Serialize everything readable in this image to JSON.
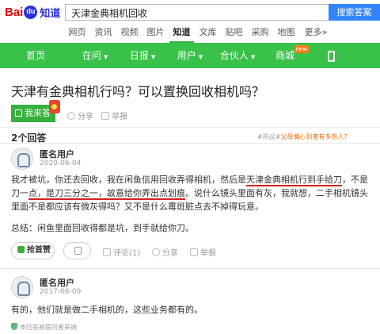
{
  "header": {
    "logo_left": "Bai",
    "logo_paw": "du",
    "logo_zhidao": "知道",
    "search_value": "天津金典相机回收",
    "search_button": "搜索答案"
  },
  "channels": [
    "网页",
    "资讯",
    "视频",
    "图片",
    "知道",
    "文库",
    "贴吧",
    "采购",
    "地图",
    "更多»"
  ],
  "channels_active_index": 4,
  "nav": {
    "items": [
      "首页",
      "在问",
      "日报",
      "用户",
      "合伙人",
      "商城"
    ],
    "new_badge": "new",
    "accent": "#38c24a"
  },
  "question": {
    "title": "天津有金典相机行吗？可以置换回收相机吗？",
    "answer_button": "我来答",
    "share": "分享",
    "report": "举报"
  },
  "answers_count": "2个回答",
  "hot": {
    "tag": "#热议#",
    "text": "父母偏心到害有多伤人？"
  },
  "answer1": {
    "user": "匿名用户",
    "date": "2020-06-04",
    "para1_a": "我才被坑，你还去回收，我在闲鱼信用回收弄得相机，然后是",
    "para1_u1": "天津金典相机行到手给刀",
    "para1_b": "，不是刀一",
    "para1_u2": "点，是刀三分之一，故意给你弄出点划痕",
    "para1_c": "。说什么镜头里面有灰，我就想，二手相机镜头里面不是都应该有微灰得吗？又不是什么霉斑脏点去不掉得玩意。",
    "para2": "总结：闲鱼里面回收得都是坑，到手就给你刀。",
    "helpful": "抢首赞",
    "comment": "评论(1)",
    "share": "分享",
    "report": "举报"
  },
  "answer2": {
    "user": "匿名用户",
    "date": "2017-06-09",
    "text": "有的，他们就是做二手相机的，这些业务都有的。",
    "adopt_note": "本回答被提问者采纳"
  }
}
